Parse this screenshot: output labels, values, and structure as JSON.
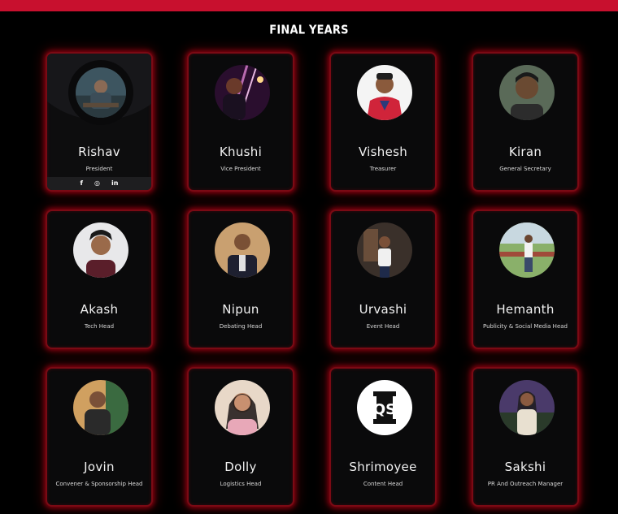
{
  "section": {
    "title": "FINAL YEARS"
  },
  "members": [
    {
      "name": "Rishav",
      "role": "President",
      "avatar": "student-at-desk-photo"
    },
    {
      "name": "Khushi",
      "role": "Vice President",
      "avatar": "portrait-photo"
    },
    {
      "name": "Vishesh",
      "role": "Treasurer",
      "avatar": "portrait-photo"
    },
    {
      "name": "Kiran",
      "role": "General Secretary",
      "avatar": "portrait-photo"
    },
    {
      "name": "Akash",
      "role": "Tech Head",
      "avatar": "portrait-photo"
    },
    {
      "name": "Nipun",
      "role": "Debating Head",
      "avatar": "portrait-photo"
    },
    {
      "name": "Urvashi",
      "role": "Event Head",
      "avatar": "portrait-photo"
    },
    {
      "name": "Hemanth",
      "role": "Publicity & Social Media Head",
      "avatar": "outdoor-portrait-photo"
    },
    {
      "name": "Jovin",
      "role": "Convener & Sponsorship Head",
      "avatar": "portrait-photo"
    },
    {
      "name": "Dolly",
      "role": "Logistics Head",
      "avatar": "portrait-photo"
    },
    {
      "name": "Shrimoyee",
      "role": "Content Head",
      "avatar": "club-logo"
    },
    {
      "name": "Sakshi",
      "role": "PR And Outreach Manager",
      "avatar": "portrait-photo"
    }
  ],
  "social_icons": [
    "facebook-icon",
    "instagram-icon",
    "linkedin-icon"
  ],
  "colors": {
    "accent": "#c8102e",
    "card_border": "#7a0a14",
    "background": "#000000"
  }
}
